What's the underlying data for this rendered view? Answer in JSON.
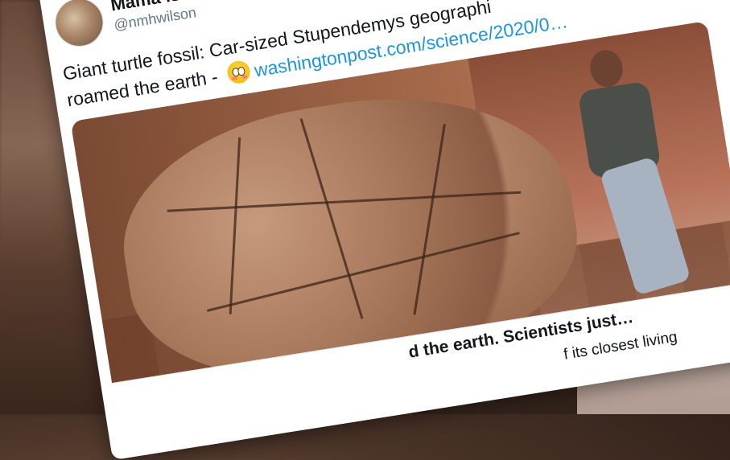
{
  "tweet": {
    "author": {
      "display_name": "Mama is Mad",
      "handle": "@nmhwilson"
    },
    "text_line_1": "Giant turtle fossil: Car-sized Stupendemys geographi",
    "text_line_2_prefix": "roamed the earth - ",
    "link_text": "washingtonpost.com/science/2020/0…",
    "emoji_name": "flushed-face-emoji"
  },
  "link_card": {
    "title": "d the earth. Scientists just…",
    "description": "f its closest living"
  },
  "colors": {
    "link": "#1b95e0",
    "text": "#14171a",
    "handle": "#657786"
  }
}
